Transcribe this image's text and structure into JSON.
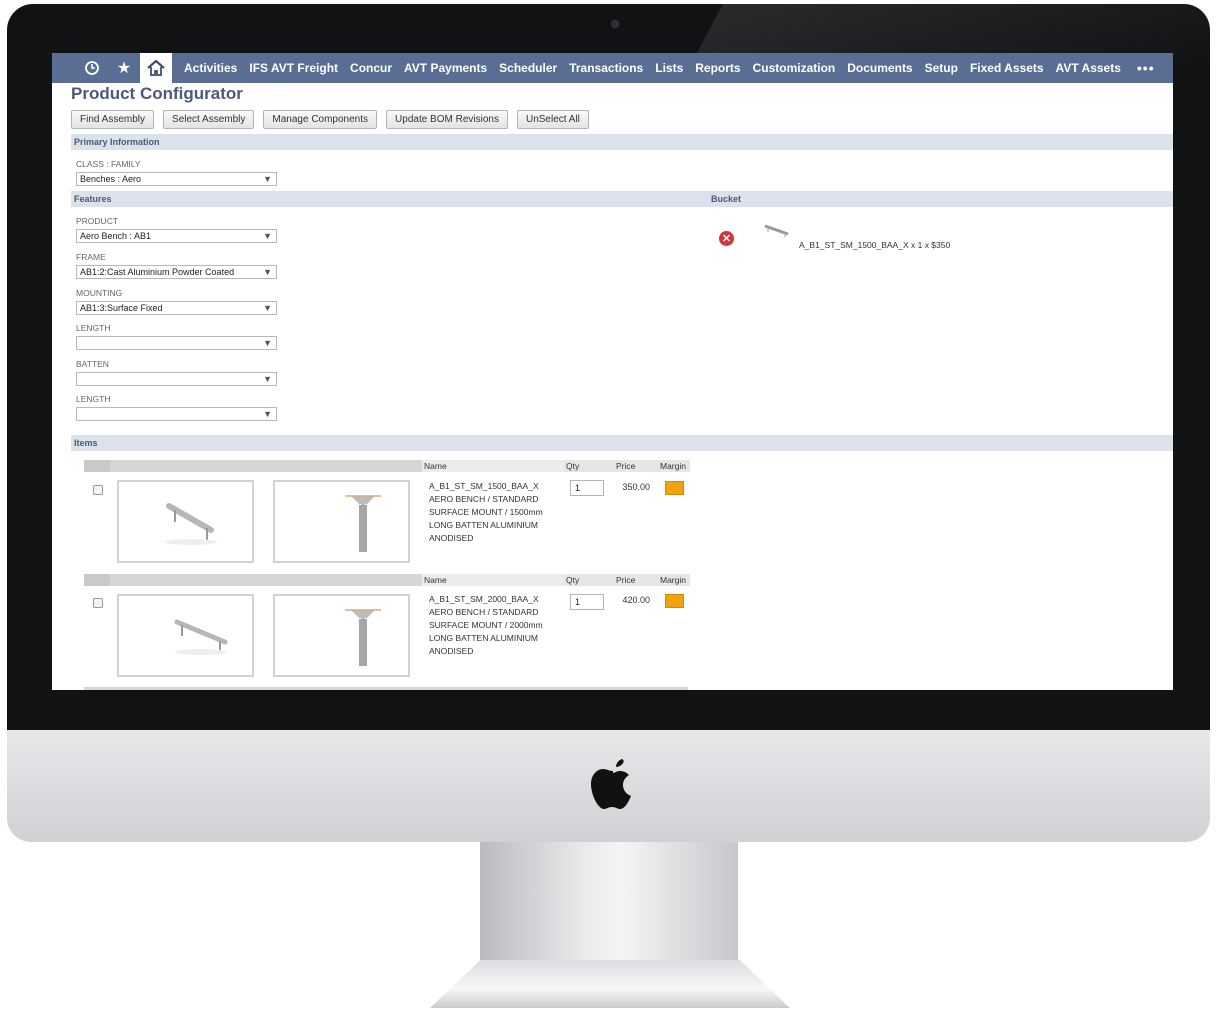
{
  "nav": {
    "icons": [
      "recent-icon",
      "star-icon",
      "home-icon"
    ],
    "items": [
      "Activities",
      "IFS AVT Freight",
      "Concur",
      "AVT Payments",
      "Scheduler",
      "Transactions",
      "Lists",
      "Reports",
      "Customization",
      "Documents",
      "Setup",
      "Fixed Assets",
      "AVT Assets"
    ],
    "more": "•••"
  },
  "page": {
    "title": "Product Configurator"
  },
  "buttons": [
    "Find Assembly",
    "Select Assembly",
    "Manage Components",
    "Update BOM Revisions",
    "UnSelect All"
  ],
  "sections": {
    "primary": "Primary Information",
    "features": "Features",
    "bucket": "Bucket",
    "items": "Items"
  },
  "primary": {
    "class_label": "CLASS : FAMILY",
    "class_value": "Benches : Aero"
  },
  "features": {
    "product_label": "PRODUCT",
    "product_value": "Aero Bench : AB1",
    "frame_label": "FRAME",
    "frame_value": "AB1:2:Cast Aluminium Powder Coated",
    "mounting_label": "MOUNTING",
    "mounting_value": "AB1:3:Surface Fixed",
    "length_label": "LENGTH",
    "length_value": "",
    "batten_label": "BATTEN",
    "batten_value": "",
    "length2_label": "LENGTH",
    "length2_value": ""
  },
  "bucket": {
    "entry": "A_B1_ST_SM_1500_BAA_X x 1 x $350"
  },
  "items_header": {
    "name": "Name",
    "qty": "Qty",
    "price": "Price",
    "margin": "Margin"
  },
  "items": [
    {
      "name_lines": [
        "A_B1_ST_SM_1500_BAA_X",
        "AERO BENCH / STANDARD",
        "SURFACE MOUNT / 1500mm",
        "LONG BATTEN ALUMINIUM",
        "ANODISED"
      ],
      "qty": "1",
      "price": "350.00",
      "margin_color": "#f2a20f"
    },
    {
      "name_lines": [
        "A_B1_ST_SM_2000_BAA_X",
        "AERO BENCH / STANDARD",
        "SURFACE MOUNT / 2000mm",
        "LONG BATTEN ALUMINIUM",
        "ANODISED"
      ],
      "qty": "1",
      "price": "420.00",
      "margin_color": "#f2a20f"
    }
  ]
}
